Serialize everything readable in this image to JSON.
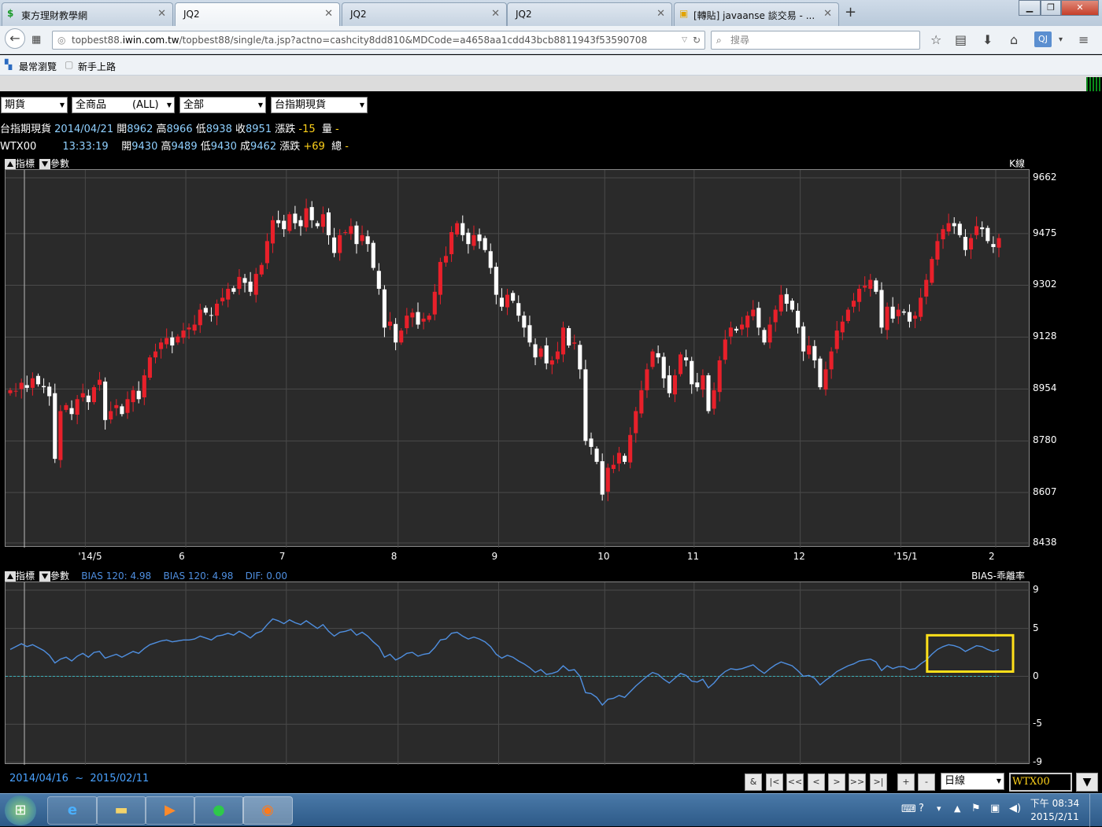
{
  "browser": {
    "tabs": [
      {
        "label": "東方理財教學網",
        "icon": "dollar-icon"
      },
      {
        "label": "JQ2",
        "active": true
      },
      {
        "label": "JQ2"
      },
      {
        "label": "JQ2"
      },
      {
        "label": "[轉貼] javaanse 談交易 - ...",
        "icon": "forum-icon"
      }
    ],
    "url_host_prefix": "topbest88.",
    "url_host": "iwin.com.tw",
    "url_path": "/topbest88/single/ta.jsp?actno=cashcity8dd810&MDCode=a4658aa1cdd43bcb8811943f53590708",
    "search_placeholder": "搜尋",
    "bookmarks": [
      "最常瀏覽",
      "新手上路"
    ]
  },
  "selectors": [
    "期貨",
    "全商品        (ALL)",
    "全部",
    "台指期現貨"
  ],
  "quote1": {
    "name": "台指期現貨",
    "date": "2014/04/21",
    "open_label": "開",
    "open": "8962",
    "high_label": "高",
    "high": "8966",
    "low_label": "低",
    "low": "8938",
    "close_label": "收",
    "close": "8951",
    "chg_label": "漲跌",
    "chg": "-15",
    "vol_label": "量",
    "vol": "-"
  },
  "quote2": {
    "name": "WTX00",
    "time": "13:33:19",
    "open_label": "開",
    "open": "9430",
    "high_label": "高",
    "high": "9489",
    "low_label": "低",
    "low": "9430",
    "close_label": "成",
    "close": "9462",
    "chg_label": "漲跌",
    "chg": "+69",
    "vol_label": "總",
    "vol": "-"
  },
  "price_panel": {
    "ind_label": "指標",
    "param_label": "參數",
    "chart_label": "K線"
  },
  "bias_panel": {
    "ind_label": "指標",
    "param_label": "參數",
    "bias_a": "BIAS 120:  4.98",
    "bias_b": "BIAS 120:  4.98",
    "dif": "DIF:    0.00",
    "chart_label": "BIAS-乖離率"
  },
  "chart_data": [
    {
      "type": "candlestick",
      "title": "K線",
      "y_ticks": [
        9662,
        9475,
        9302,
        9128,
        8954,
        8780,
        8607,
        8438
      ],
      "ylim": [
        8438,
        9662
      ],
      "x_ticks": [
        "'14/5",
        "6",
        "7",
        "8",
        "9",
        "10",
        "11",
        "12",
        "'15/1",
        "2"
      ],
      "colors": {
        "up": "#e8202a",
        "down": "#ffffff"
      },
      "grid": true,
      "closes": [
        8950,
        8948,
        8975,
        8958,
        8990,
        8970,
        8960,
        8930,
        8720,
        8880,
        8900,
        8870,
        8920,
        8940,
        8910,
        8960,
        8985,
        8850,
        8880,
        8900,
        8870,
        8920,
        8950,
        8920,
        9000,
        9060,
        9080,
        9110,
        9125,
        9100,
        9130,
        9150,
        9160,
        9170,
        9220,
        9210,
        9200,
        9240,
        9260,
        9290,
        9280,
        9330,
        9310,
        9280,
        9340,
        9370,
        9450,
        9520,
        9510,
        9490,
        9540,
        9510,
        9500,
        9560,
        9520,
        9500,
        9540,
        9470,
        9410,
        9470,
        9480,
        9500,
        9440,
        9470,
        9440,
        9360,
        9290,
        9160,
        9180,
        9110,
        9150,
        9200,
        9210,
        9170,
        9190,
        9200,
        9280,
        9380,
        9400,
        9480,
        9510,
        9470,
        9440,
        9470,
        9450,
        9420,
        9360,
        9270,
        9230,
        9270,
        9250,
        9200,
        9160,
        9110,
        9060,
        9090,
        9040,
        9050,
        9080,
        9160,
        9100,
        9110,
        9020,
        8780,
        8760,
        8710,
        8600,
        8690,
        8700,
        8740,
        8710,
        8800,
        8880,
        8950,
        9020,
        9080,
        9060,
        8990,
        8940,
        9000,
        9070,
        9050,
        8970,
        8960,
        9000,
        8880,
        8950,
        9050,
        9120,
        9160,
        9150,
        9170,
        9200,
        9220,
        9160,
        9110,
        9170,
        9220,
        9270,
        9240,
        9220,
        9160,
        9080,
        9100,
        9050,
        8960,
        9020,
        9080,
        9150,
        9180,
        9220,
        9250,
        9290,
        9300,
        9320,
        9280,
        9160,
        9230,
        9190,
        9220,
        9210,
        9180,
        9200,
        9260,
        9320,
        9390,
        9450,
        9490,
        9510,
        9500,
        9470,
        9420,
        9460,
        9500,
        9490,
        9450,
        9430,
        9460
      ]
    },
    {
      "type": "line",
      "title": "BIAS-乖離率",
      "series": [
        {
          "name": "BIAS 120",
          "color": "#4f8fe0"
        }
      ],
      "y_ticks": [
        9,
        5,
        0,
        -5,
        -9
      ],
      "ylim": [
        -9,
        9
      ],
      "zero_line_color": "#3ab0b8",
      "highlight": {
        "from_index": 165,
        "to_index": 178,
        "color": "#ffe01a"
      },
      "values": [
        2.8,
        3.1,
        3.4,
        3.1,
        3.3,
        3.0,
        2.7,
        2.2,
        1.4,
        1.8,
        2.0,
        1.6,
        2.1,
        2.4,
        2.0,
        2.5,
        2.6,
        1.9,
        2.1,
        2.3,
        2.0,
        2.3,
        2.6,
        2.4,
        2.9,
        3.3,
        3.5,
        3.7,
        3.8,
        3.6,
        3.7,
        3.8,
        3.8,
        3.9,
        4.2,
        4.0,
        3.8,
        4.2,
        4.3,
        4.5,
        4.3,
        4.7,
        4.4,
        4.0,
        4.5,
        4.7,
        5.4,
        6.0,
        5.8,
        5.5,
        5.9,
        5.6,
        5.4,
        5.8,
        5.4,
        5.0,
        5.4,
        4.7,
        4.2,
        4.6,
        4.7,
        4.9,
        4.3,
        4.6,
        4.2,
        3.6,
        3.1,
        2.0,
        2.3,
        1.7,
        2.0,
        2.4,
        2.5,
        2.1,
        2.3,
        2.4,
        3.0,
        3.8,
        3.9,
        4.5,
        4.6,
        4.2,
        3.9,
        4.1,
        3.9,
        3.6,
        3.1,
        2.3,
        1.9,
        2.2,
        2.0,
        1.6,
        1.3,
        0.9,
        0.4,
        0.7,
        0.2,
        0.3,
        0.5,
        1.1,
        0.6,
        0.7,
        0.0,
        -1.7,
        -1.8,
        -2.2,
        -3.0,
        -2.4,
        -2.3,
        -2.0,
        -2.2,
        -1.6,
        -1.0,
        -0.5,
        0.0,
        0.4,
        0.2,
        -0.3,
        -0.7,
        -0.2,
        0.3,
        0.1,
        -0.5,
        -0.6,
        -0.3,
        -1.2,
        -0.7,
        0.0,
        0.5,
        0.8,
        0.7,
        0.8,
        1.0,
        1.2,
        0.7,
        0.3,
        0.8,
        1.2,
        1.5,
        1.3,
        1.1,
        0.6,
        0.0,
        0.1,
        -0.2,
        -0.9,
        -0.4,
        0.0,
        0.5,
        0.8,
        1.1,
        1.3,
        1.6,
        1.7,
        1.8,
        1.5,
        0.6,
        1.1,
        0.8,
        1.0,
        1.0,
        0.7,
        0.8,
        1.3,
        1.7,
        2.3,
        2.8,
        3.1,
        3.3,
        3.2,
        3.0,
        2.6,
        2.9,
        3.2,
        3.1,
        2.8,
        2.6,
        2.8
      ]
    }
  ],
  "bottom_bar": {
    "date_from": "2014/04/16",
    "tilde": "~",
    "date_to": "2015/02/11",
    "controls": [
      "&",
      "|<",
      "<<",
      "<",
      ">",
      ">>",
      ">|",
      "+",
      "-"
    ],
    "period": "日線",
    "symbol": "WTX00"
  },
  "taskbar": {
    "apps": [
      "start-orb",
      "ie-icon",
      "explorer-icon",
      "media-player-icon",
      "line-icon",
      "firefox-icon"
    ],
    "time": "下午 08:34",
    "date": "2015/2/11"
  }
}
